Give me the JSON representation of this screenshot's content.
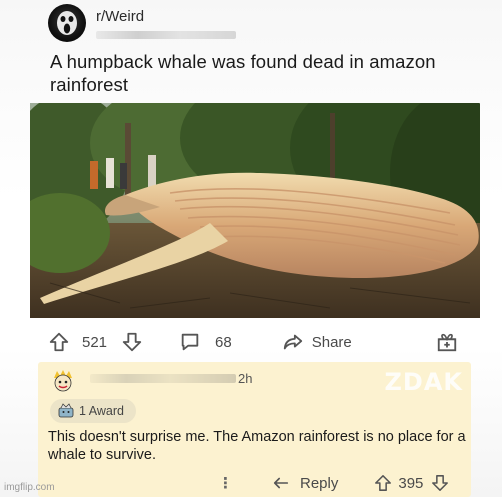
{
  "post": {
    "subreddit": "r/Weird",
    "title": "A humpback whale was found dead in amazon rainforest",
    "upvotes": "521",
    "comments": "68",
    "share_label": "Share"
  },
  "comment": {
    "time": "2h",
    "award_label": "1 Award",
    "body": "This doesn't surprise me. The Amazon rainforest is no place for a whale to survive.",
    "more_label": "⋮",
    "reply_label": "Reply",
    "score": "395"
  },
  "watermark": "ZDAK",
  "credit": "imgflip.com",
  "colors": {
    "comment_bg": "#fcf2d0",
    "award_pill_bg": "#ece4c8",
    "icon_gray": "#555555"
  }
}
